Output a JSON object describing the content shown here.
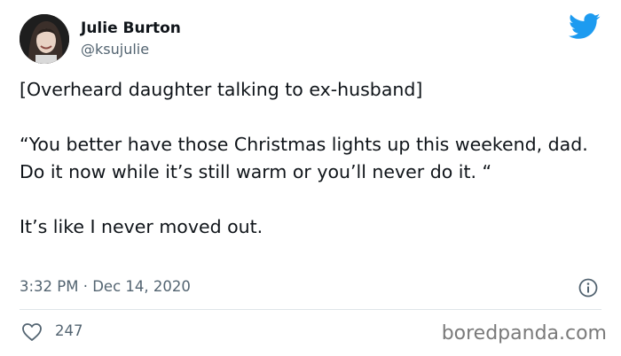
{
  "author": {
    "display_name": "Julie Burton",
    "handle": "@ksujulie"
  },
  "icons": {
    "platform": "twitter-bird-icon",
    "info": "info-icon",
    "like": "heart-icon"
  },
  "colors": {
    "brand": "#1d9bf0",
    "text": "#0f1419",
    "secondary": "#536471",
    "divider": "#dfe5e9"
  },
  "tweet": {
    "line_1": "[Overheard daughter talking to ex-husband]",
    "line_2": "“You better have those Christmas lights up this weekend, dad. Do it now while it’s still warm or you’ll never do it. “",
    "line_3": "It’s like I never moved out.",
    "timestamp": "3:32 PM · Dec 14, 2020",
    "likes": "247"
  },
  "watermark": "boredpanda.com"
}
